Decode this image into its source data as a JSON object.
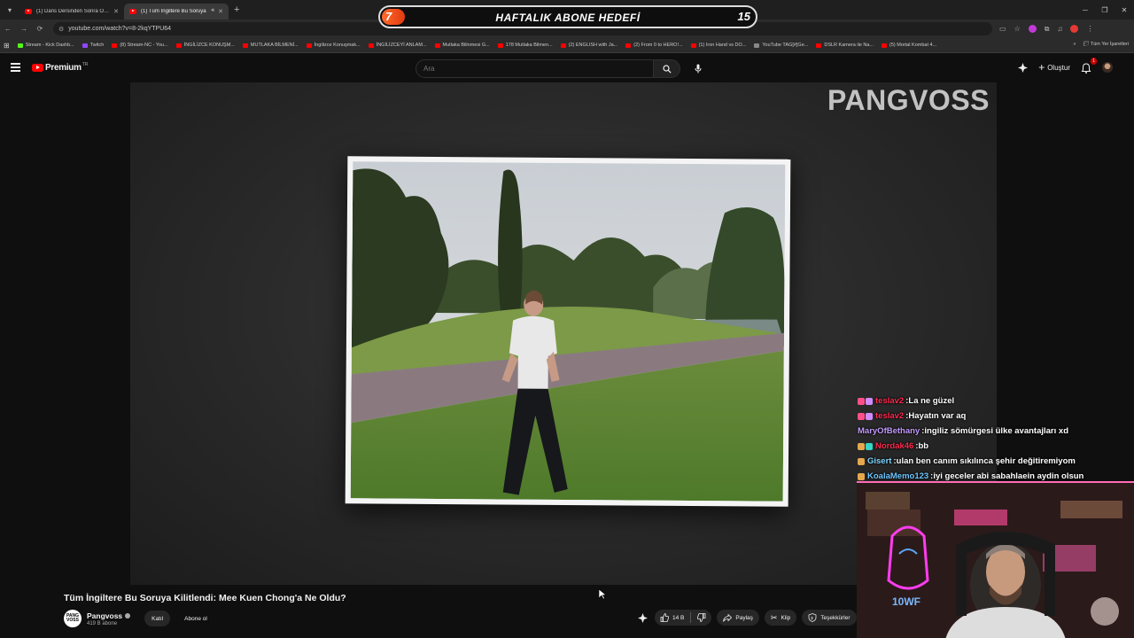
{
  "browser": {
    "tabs": [
      {
        "title": "(1) Dans Dersinden Sonra Ortad",
        "active": false,
        "audio": false
      },
      {
        "title": "(1) Tüm İngiltere Bu Soruya",
        "active": true,
        "audio": true
      }
    ],
    "url": "youtube.com/watch?v=8-2kqYTPU64",
    "bookmarks": [
      {
        "label": "Stream - Kick Dashb...",
        "icon": "kick"
      },
      {
        "label": "Twitch",
        "icon": "twitch"
      },
      {
        "label": "(8) Stream-NC - You...",
        "icon": "youtube"
      },
      {
        "label": "İNGİLİZCE KONUŞM...",
        "icon": "youtube"
      },
      {
        "label": "MUTLAKA BİLMENİ...",
        "icon": "youtube"
      },
      {
        "label": "İngilizce Konuşmak...",
        "icon": "youtube"
      },
      {
        "label": "İNGİLİZCEYİ ANLAM...",
        "icon": "youtube"
      },
      {
        "label": "Mutlaka Bilinmesi G...",
        "icon": "youtube"
      },
      {
        "label": "178 Mutlaka Bilmen...",
        "icon": "youtube"
      },
      {
        "label": "(2) ENGLISH with Ja...",
        "icon": "youtube"
      },
      {
        "label": "(2) From 0 to HERO!...",
        "icon": "youtube"
      },
      {
        "label": "(1) Iron Hand vs DO...",
        "icon": "youtube"
      },
      {
        "label": "YouTube TAG[#]Ge...",
        "icon": "tag"
      },
      {
        "label": "DSLR Kamera ile Na...",
        "icon": "youtube"
      },
      {
        "label": "(5) Mortal Kombat 4...",
        "icon": "youtube"
      }
    ],
    "bookmarks_more": "»",
    "all_bookmarks": "Tüm Yer İşaretleri"
  },
  "goal": {
    "current": "7",
    "title": "HAFTALIK ABONE HEDEFİ",
    "target": "15",
    "progress": 0.0
  },
  "youtube": {
    "logo_text": "Premium",
    "logo_region": "TR",
    "search_placeholder": "Ara",
    "create_label": "Oluştur",
    "notification_count": "1"
  },
  "video": {
    "brand_watermark": "PANGVOSS",
    "title": "Tüm İngiltere Bu Soruya Kilitlendi: Mee Kuen Chong'a Ne Oldu?",
    "channel_avatar_text": "PANG VOSS",
    "channel_name": "Pangvoss",
    "subscribers": "419 B abone",
    "join_label": "Katıl",
    "subscribe_label": "Abone ol",
    "likes": "14 B",
    "share_label": "Paylaş",
    "clip_label": "Klip",
    "thanks_label": "Teşekkürler"
  },
  "chat": [
    {
      "user": "teslav2",
      "color": "#ff2a4f",
      "message": "La ne güzel",
      "badges": [
        "#ff4f8b",
        "#d18cff"
      ]
    },
    {
      "user": "teslav2",
      "color": "#ff2a4f",
      "message": "Hayatın var aq",
      "badges": [
        "#ff4f8b",
        "#d18cff"
      ]
    },
    {
      "user": "MaryOfBethany",
      "color": "#c39bff",
      "message": "ingiliz sömürgesi ülke avantajları xd",
      "badges": []
    },
    {
      "user": "Nordak46",
      "color": "#ff2a4f",
      "message": "bb",
      "badges": [
        "#e5a84c",
        "#35d6c7"
      ]
    },
    {
      "user": "Gisert",
      "color": "#7fd7ff",
      "message": "ulan ben canım sıkılınca şehir değitiremiyom",
      "badges": [
        "#e5a84c"
      ]
    },
    {
      "user": "KoalaMemo123",
      "color": "#6ec5ff",
      "message": "iyi geceler abi sabahlaein aydin olsun",
      "badges": [
        "#e5a84c"
      ]
    }
  ],
  "colors": {
    "accent": "#ff0000",
    "goal_fill": "#ff5a1f",
    "background": "#0f0f0f"
  }
}
